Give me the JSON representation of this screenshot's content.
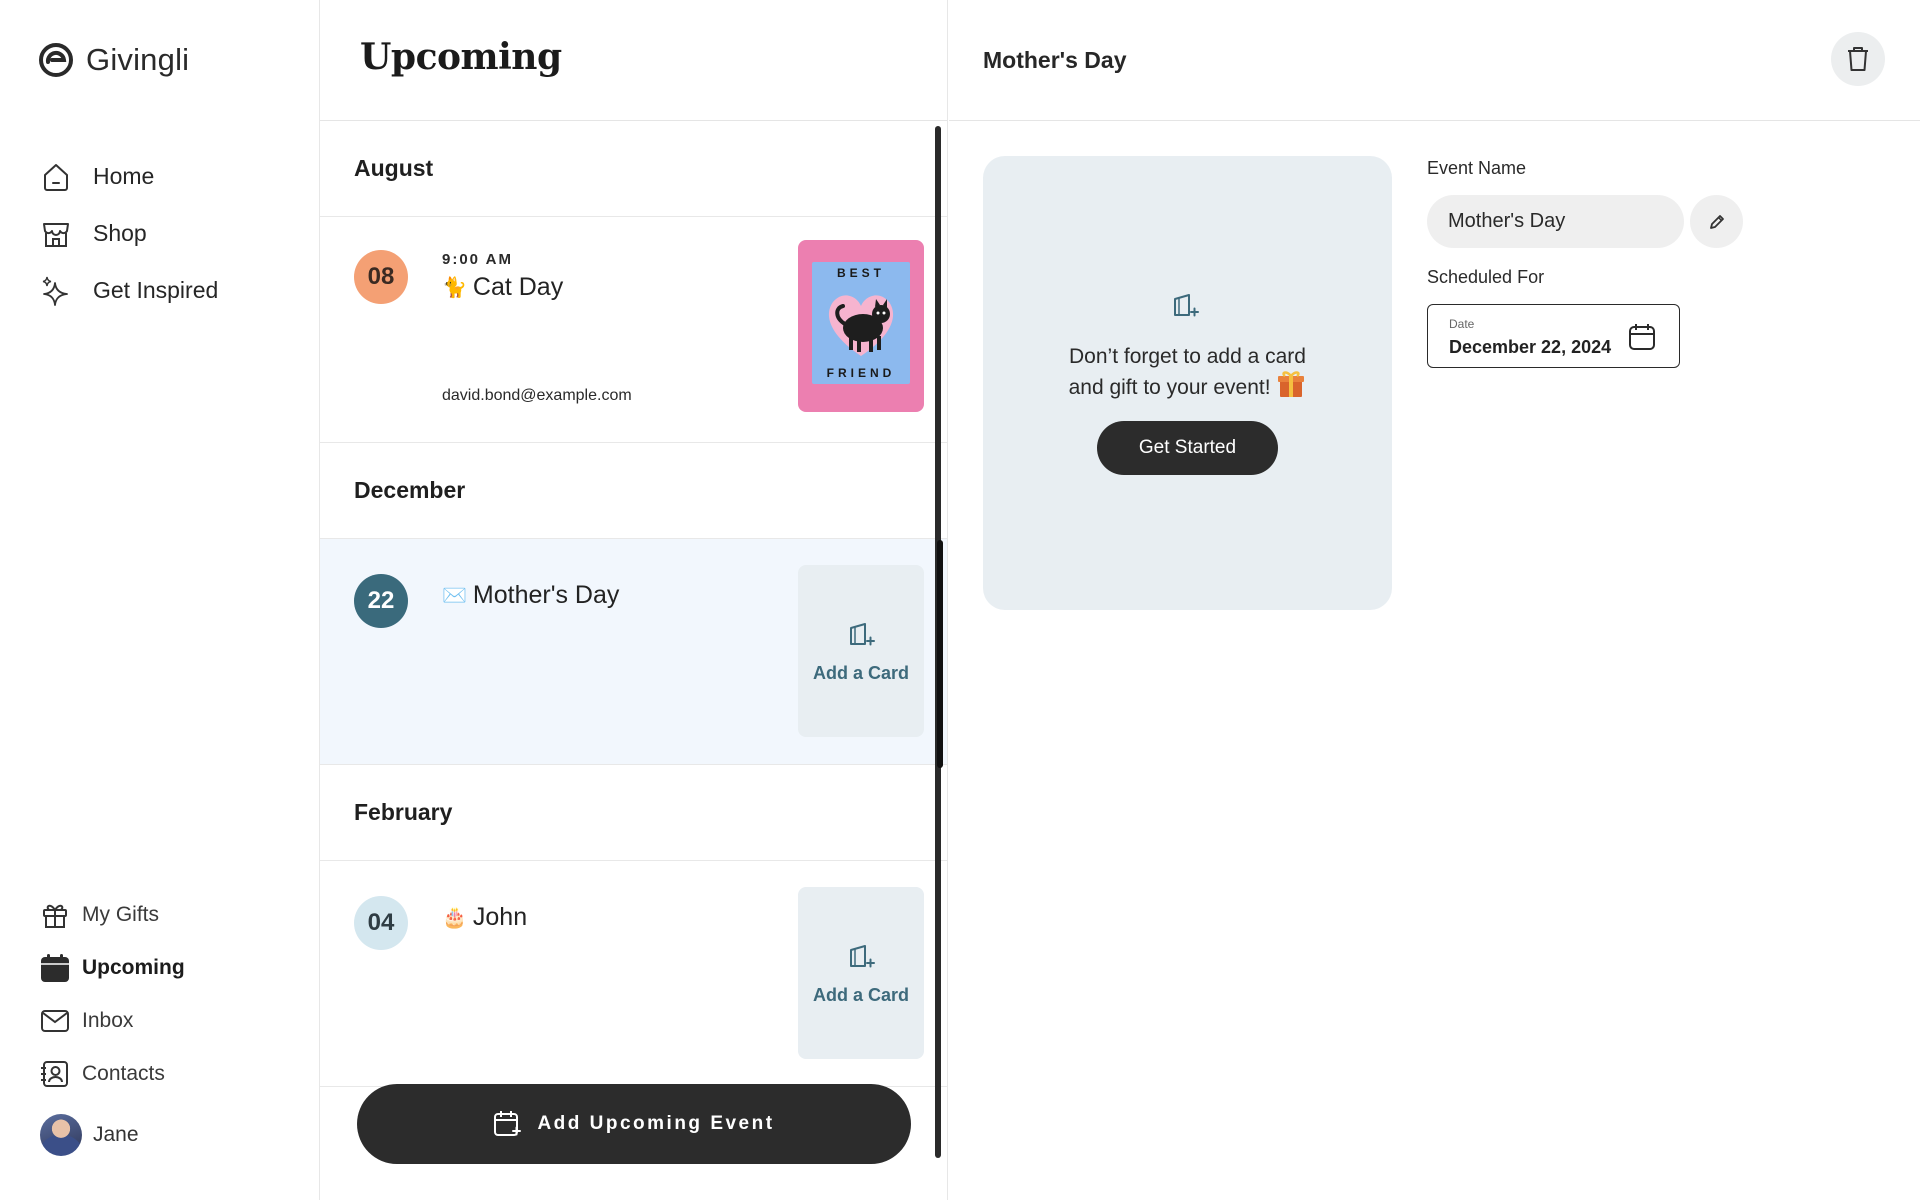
{
  "brand": {
    "name": "Givingli"
  },
  "nav_main": [
    {
      "label": "Home",
      "icon": "home-icon"
    },
    {
      "label": "Shop",
      "icon": "shop-icon"
    },
    {
      "label": "Get Inspired",
      "icon": "sparkle-icon"
    }
  ],
  "nav_secondary": [
    {
      "label": "My Gifts",
      "icon": "gift-icon",
      "active": false
    },
    {
      "label": "Upcoming",
      "icon": "calendar-icon",
      "active": true
    },
    {
      "label": "Inbox",
      "icon": "mail-icon",
      "active": false
    },
    {
      "label": "Contacts",
      "icon": "contacts-icon",
      "active": false
    }
  ],
  "user": {
    "name": "Jane"
  },
  "upcoming": {
    "title": "Upcoming",
    "months": [
      "August",
      "December",
      "February"
    ],
    "events": [
      {
        "day": "08",
        "time": "9:00 AM",
        "emoji": "🐈",
        "title": "Cat Day",
        "email": "david.bond@example.com",
        "card": {
          "type": "image",
          "text_top": "BEST",
          "text_bottom": "FRIEND"
        },
        "badge_color": "#f4a074",
        "selected": false
      },
      {
        "day": "22",
        "emoji": "✉️",
        "title": "Mother's Day",
        "card": {
          "type": "add",
          "label": "Add a Card"
        },
        "badge_color": "#3a6a7c",
        "selected": true
      },
      {
        "day": "04",
        "emoji": "🎂",
        "title": "John",
        "card": {
          "type": "add",
          "label": "Add a Card"
        },
        "badge_color": "#d4e7ef",
        "selected": false
      }
    ],
    "add_button": "Add Upcoming Event"
  },
  "detail": {
    "title": "Mother's Day",
    "promo": {
      "line1": "Don’t forget to add a card",
      "line2": "and gift to your event!",
      "button": "Get Started"
    },
    "event_name_label": "Event Name",
    "event_name_value": "Mother's Day",
    "scheduled_label": "Scheduled For",
    "date_caption": "Date",
    "date_value": "December 22, 2024"
  },
  "colors": {
    "dark": "#2c2c2c",
    "accent_teal": "#3a6a7c",
    "selected_row": "#f2f7fd",
    "card_bg": "#e8eef2"
  }
}
